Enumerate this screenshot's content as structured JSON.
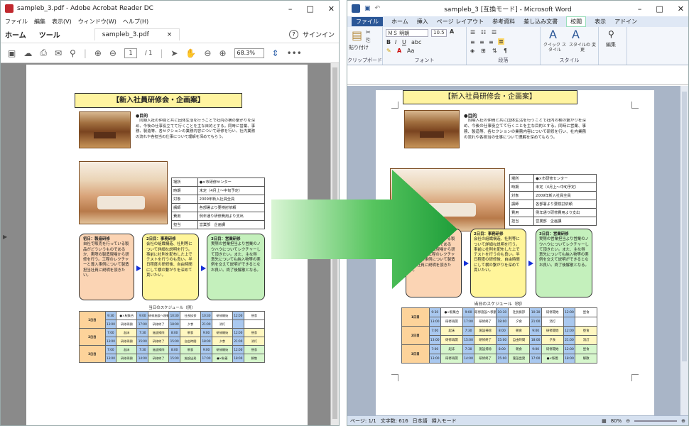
{
  "acrobat": {
    "title": "sampleb_3.pdf - Adobe Acrobat Reader DC",
    "menu": [
      "ファイル",
      "編集",
      "表示(V)",
      "ウィンドウ(W)",
      "ヘルプ(H)"
    ],
    "nav_home": "ホーム",
    "nav_tools": "ツール",
    "tab_label": "sampleb_3.pdf",
    "tab_close": "×",
    "signin": "サインイン",
    "help": "?",
    "page_current": "1",
    "page_total": "/ 1",
    "zoom": "68.3%",
    "more": "•••"
  },
  "word": {
    "title": "sampleb_3 [互換モード] - Microsoft Word",
    "tabs": [
      "ファイル",
      "ホーム",
      "挿入",
      "ページ レイアウト",
      "参考資料",
      "差し込み文書",
      "校閲",
      "表示",
      "アドイン"
    ],
    "ribbon": {
      "clipboard": "クリップボード",
      "paste": "貼り付け",
      "font_name": "ＭＳ 明朝",
      "font_size": "10.5",
      "font": "フォント",
      "paragraph": "段落",
      "quick_style": "クイック スタイル",
      "change_style": "スタイルの 変更",
      "style": "スタイル",
      "edit": "編集"
    },
    "status": {
      "page": "ページ: 1/1",
      "words": "文字数: 616",
      "lang": "日本語",
      "mode": "挿入モード",
      "zoom": "80%"
    }
  },
  "document": {
    "title": "【新入社員研修会・企画案】",
    "purpose_heading": "●目的",
    "purpose_text": "同期入社の仲間と共に団体生活を行うことで社内の横の繋がりを深め、今後の仕事役立てて行くことを主な目的とする。同時に営業、事務、製造等、各セクションの業務内容について研修を行い、社内業務の流れや各担当の仕事について理解を深めてもらう。",
    "info": [
      {
        "k": "場所",
        "v": "●×市研修センター"
      },
      {
        "k": "時期",
        "v": "未定（4月上～中旬予定）"
      },
      {
        "k": "対象",
        "v": "2009年新入社員全員"
      },
      {
        "k": "講師",
        "v": "各部署より要検討依頼"
      },
      {
        "k": "費用",
        "v": "例年通り研修費用より支出"
      },
      {
        "k": "担当",
        "v": "営業部　企画課"
      }
    ],
    "boxes": [
      {
        "h": "初日：製造研修",
        "t": "自社で販売を行っている製品がどういうものであるか、実際の製造現場から研修を行う。工程のレクチャーと導入事例について製造担当社員に説明を頂きたい。"
      },
      {
        "h": "2日目：事務研修",
        "t": "会社の組織構造、社則等について詳細な説明を行う。事前に社則を配布した上でテストを行うのも良い。半日程度の研修後、自由時間にして横の繋がりを深めて貰いたい。"
      },
      {
        "h": "3日目：営業研修",
        "t": "実際の営業担当より営業のノウハウについてレクチャーして頂きたい。また、主な得意先についても納入物等の実例を交えて説明ができるとなお良い。終了後解散となる。"
      }
    ],
    "schedule_title": "当日のスケジュール（例）",
    "schedule": [
      {
        "day": "1日目",
        "rows": [
          [
            "9:30",
            "●×駅集合",
            "9:00",
            "研修施設へ移動",
            "10:30",
            "社長挨拶",
            "10:30",
            "研修開始",
            "12:00",
            "昼食"
          ],
          [
            "13:00",
            "研修再開",
            "17:00",
            "研修終了",
            "18:00",
            "夕食",
            "21:00",
            "消灯",
            "",
            ""
          ]
        ]
      },
      {
        "day": "2日目",
        "rows": [
          [
            "7:00",
            "起床",
            "7:30",
            "施設掃除",
            "8:00",
            "朝食",
            "9:00",
            "研修開始",
            "12:00",
            "昼食"
          ],
          [
            "13:00",
            "研修再開",
            "15:00",
            "研修終了",
            "15:00",
            "自由時間",
            "18:00",
            "夕食",
            "21:00",
            "消灯"
          ]
        ]
      },
      {
        "day": "3日目",
        "rows": [
          [
            "7:00",
            "起床",
            "7:30",
            "施設掃除",
            "8:00",
            "朝食",
            "9:00",
            "研修開始",
            "12:00",
            "昼食"
          ],
          [
            "13:00",
            "研修再開",
            "14:00",
            "研修終了",
            "15:00",
            "施設出発",
            "17:00",
            "●×駅着",
            "18:00",
            "解散"
          ]
        ]
      }
    ]
  },
  "colors": {
    "title_fill": "#fff4a0",
    "box1": "#fbd4b4",
    "box2": "#fff59a",
    "box3": "#c4f0bc",
    "arrow_dark": "#1e9e3a",
    "arrow_light": "#c8f0c0",
    "word_blue": "#2b5797"
  }
}
